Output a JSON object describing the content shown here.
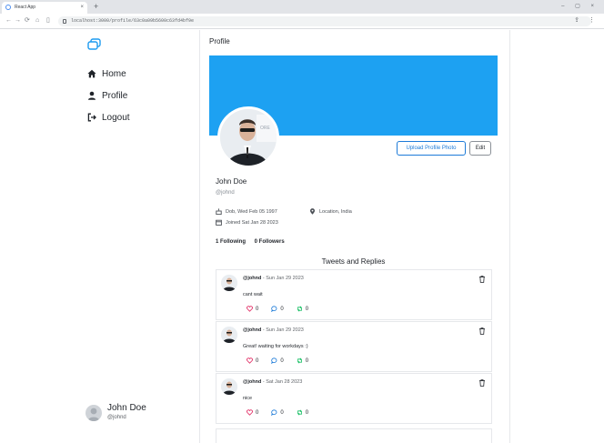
{
  "browser": {
    "tab_title": "React App",
    "tab_close": "×",
    "new_tab": "+",
    "window_controls": "– ▢ ×",
    "url": "localhost:3000/profile/63c0a09b5600c63fd4bf9e",
    "nav_back": "←",
    "nav_forward": "→",
    "nav_reload": "⟳",
    "toolbar_right": "⇪ ⋮"
  },
  "sidebar": {
    "items": [
      {
        "label": "Home",
        "icon": "home-icon"
      },
      {
        "label": "Profile",
        "icon": "person-icon"
      },
      {
        "label": "Logout",
        "icon": "logout-icon"
      }
    ],
    "user": {
      "name": "John Doe",
      "handle": "@johnd"
    }
  },
  "main": {
    "page_title": "Profile",
    "upload_button": "Upload Profile Photo",
    "edit_button": "Edit",
    "profile": {
      "name": "John Doe",
      "handle": "@johnd",
      "dob": "Dob, Wed Feb 05 1997",
      "location": "Location, India",
      "joined": "Joined Sat Jan 28 2023",
      "following": "1 Following",
      "followers": "0 Followers"
    },
    "tweets_title": "Tweets and Replies",
    "tweets": [
      {
        "handle": "@johnd",
        "date": "- Sun Jan 29 2023",
        "text": "cant wait",
        "likes": "0",
        "replies": "0",
        "retweets": "0"
      },
      {
        "handle": "@johnd",
        "date": "- Sun Jan 29 2023",
        "text": "Great! waiting for workdays :)",
        "likes": "0",
        "replies": "0",
        "retweets": "0"
      },
      {
        "handle": "@johnd",
        "date": "- Sat Jan 28 2023",
        "text": "nice",
        "likes": "0",
        "replies": "0",
        "retweets": "0"
      }
    ]
  },
  "colors": {
    "cover": "#1da1f2",
    "like": "#e0245e",
    "reply": "#1d7bd8",
    "retweet": "#17bf63"
  }
}
